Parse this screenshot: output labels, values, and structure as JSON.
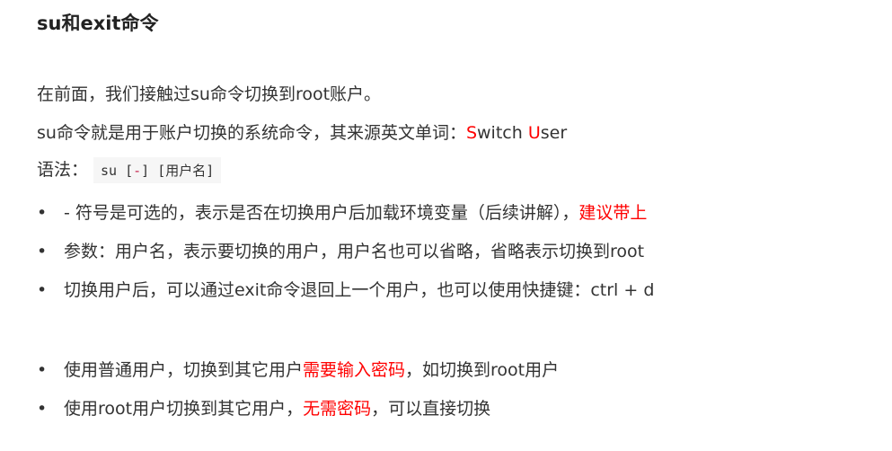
{
  "title": "su和exit命令",
  "p1": "在前面，我们接触过su命令切换到root账户。",
  "p2": {
    "a": "su命令就是用于账户切换的系统命令，其来源英文单词：",
    "s": "S",
    "w": "witch ",
    "u": "U",
    "ser": "ser"
  },
  "syntax": {
    "label": "语法：",
    "c1": "su [",
    "c2": "-",
    "c3": "] [用户名]"
  },
  "bullet": "•",
  "list1": [
    {
      "a": "- 符号是可选的，表示是否在切换用户后加载环境变量（后续讲解），",
      "r": "建议带上"
    },
    {
      "a": "参数：用户名，表示要切换的用户，用户名也可以省略，省略表示切换到root"
    },
    {
      "r": "切换用户后，可以通过exit命令退回上一个用户，也可以使用快捷键：ctrl + d"
    }
  ],
  "list2": [
    {
      "a": "使用普通用户，切换到其它用户",
      "r": "需要输入密码",
      "b": "，如切换到root用户"
    },
    {
      "a": "使用root用户切换到其它用户，",
      "r": "无需密码",
      "b": "，可以直接切换"
    }
  ]
}
